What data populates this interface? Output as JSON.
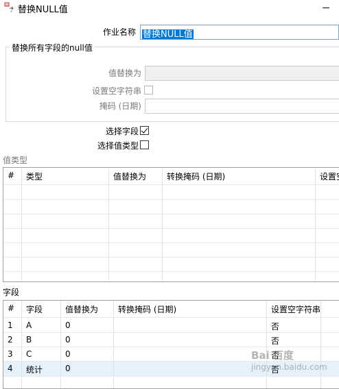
{
  "window": {
    "title": "替换NULL值",
    "icon": "replace-null-icon"
  },
  "form": {
    "job_name_label": "作业名称",
    "job_name_value": "替换NULL值"
  },
  "all_fields_group": {
    "title": "替换所有字段的null值",
    "replace_with_label": "值替换为",
    "replace_with_value": "",
    "set_empty_string_label": "设置空字符串",
    "set_empty_string_checked": false,
    "mask_label": "掩码 (日期)",
    "mask_value": ""
  },
  "options": {
    "select_fields_label": "选择字段",
    "select_fields_checked": true,
    "select_value_types_label": "选择值类型",
    "select_value_types_checked": false
  },
  "value_types_section": {
    "title": "值类型",
    "columns": [
      "#",
      "类型",
      "值替换为",
      "转换掩码 (日期)",
      "设置空字"
    ],
    "rows": []
  },
  "fields_section": {
    "title": "字段",
    "columns": [
      "#",
      "字段",
      "值替换为",
      "转换掩码 (日期)",
      "设置空字符串"
    ],
    "rows": [
      {
        "num": "1",
        "field": "A",
        "value": "0",
        "mask": "",
        "empty": "否"
      },
      {
        "num": "2",
        "field": "B",
        "value": "0",
        "mask": "",
        "empty": "否"
      },
      {
        "num": "3",
        "field": "C",
        "value": "0",
        "mask": "",
        "empty": "否"
      },
      {
        "num": "4",
        "field": "统计",
        "value": "0",
        "mask": "",
        "empty": "否"
      }
    ],
    "selected_row": 3
  },
  "watermark": {
    "line1": "Bai 百度",
    "line2": "jingyan.baidu.com"
  },
  "colors": {
    "selection": "#0078d7",
    "row_highlight": "#e5f1fb",
    "disabled_text": "#7a7a7a"
  }
}
